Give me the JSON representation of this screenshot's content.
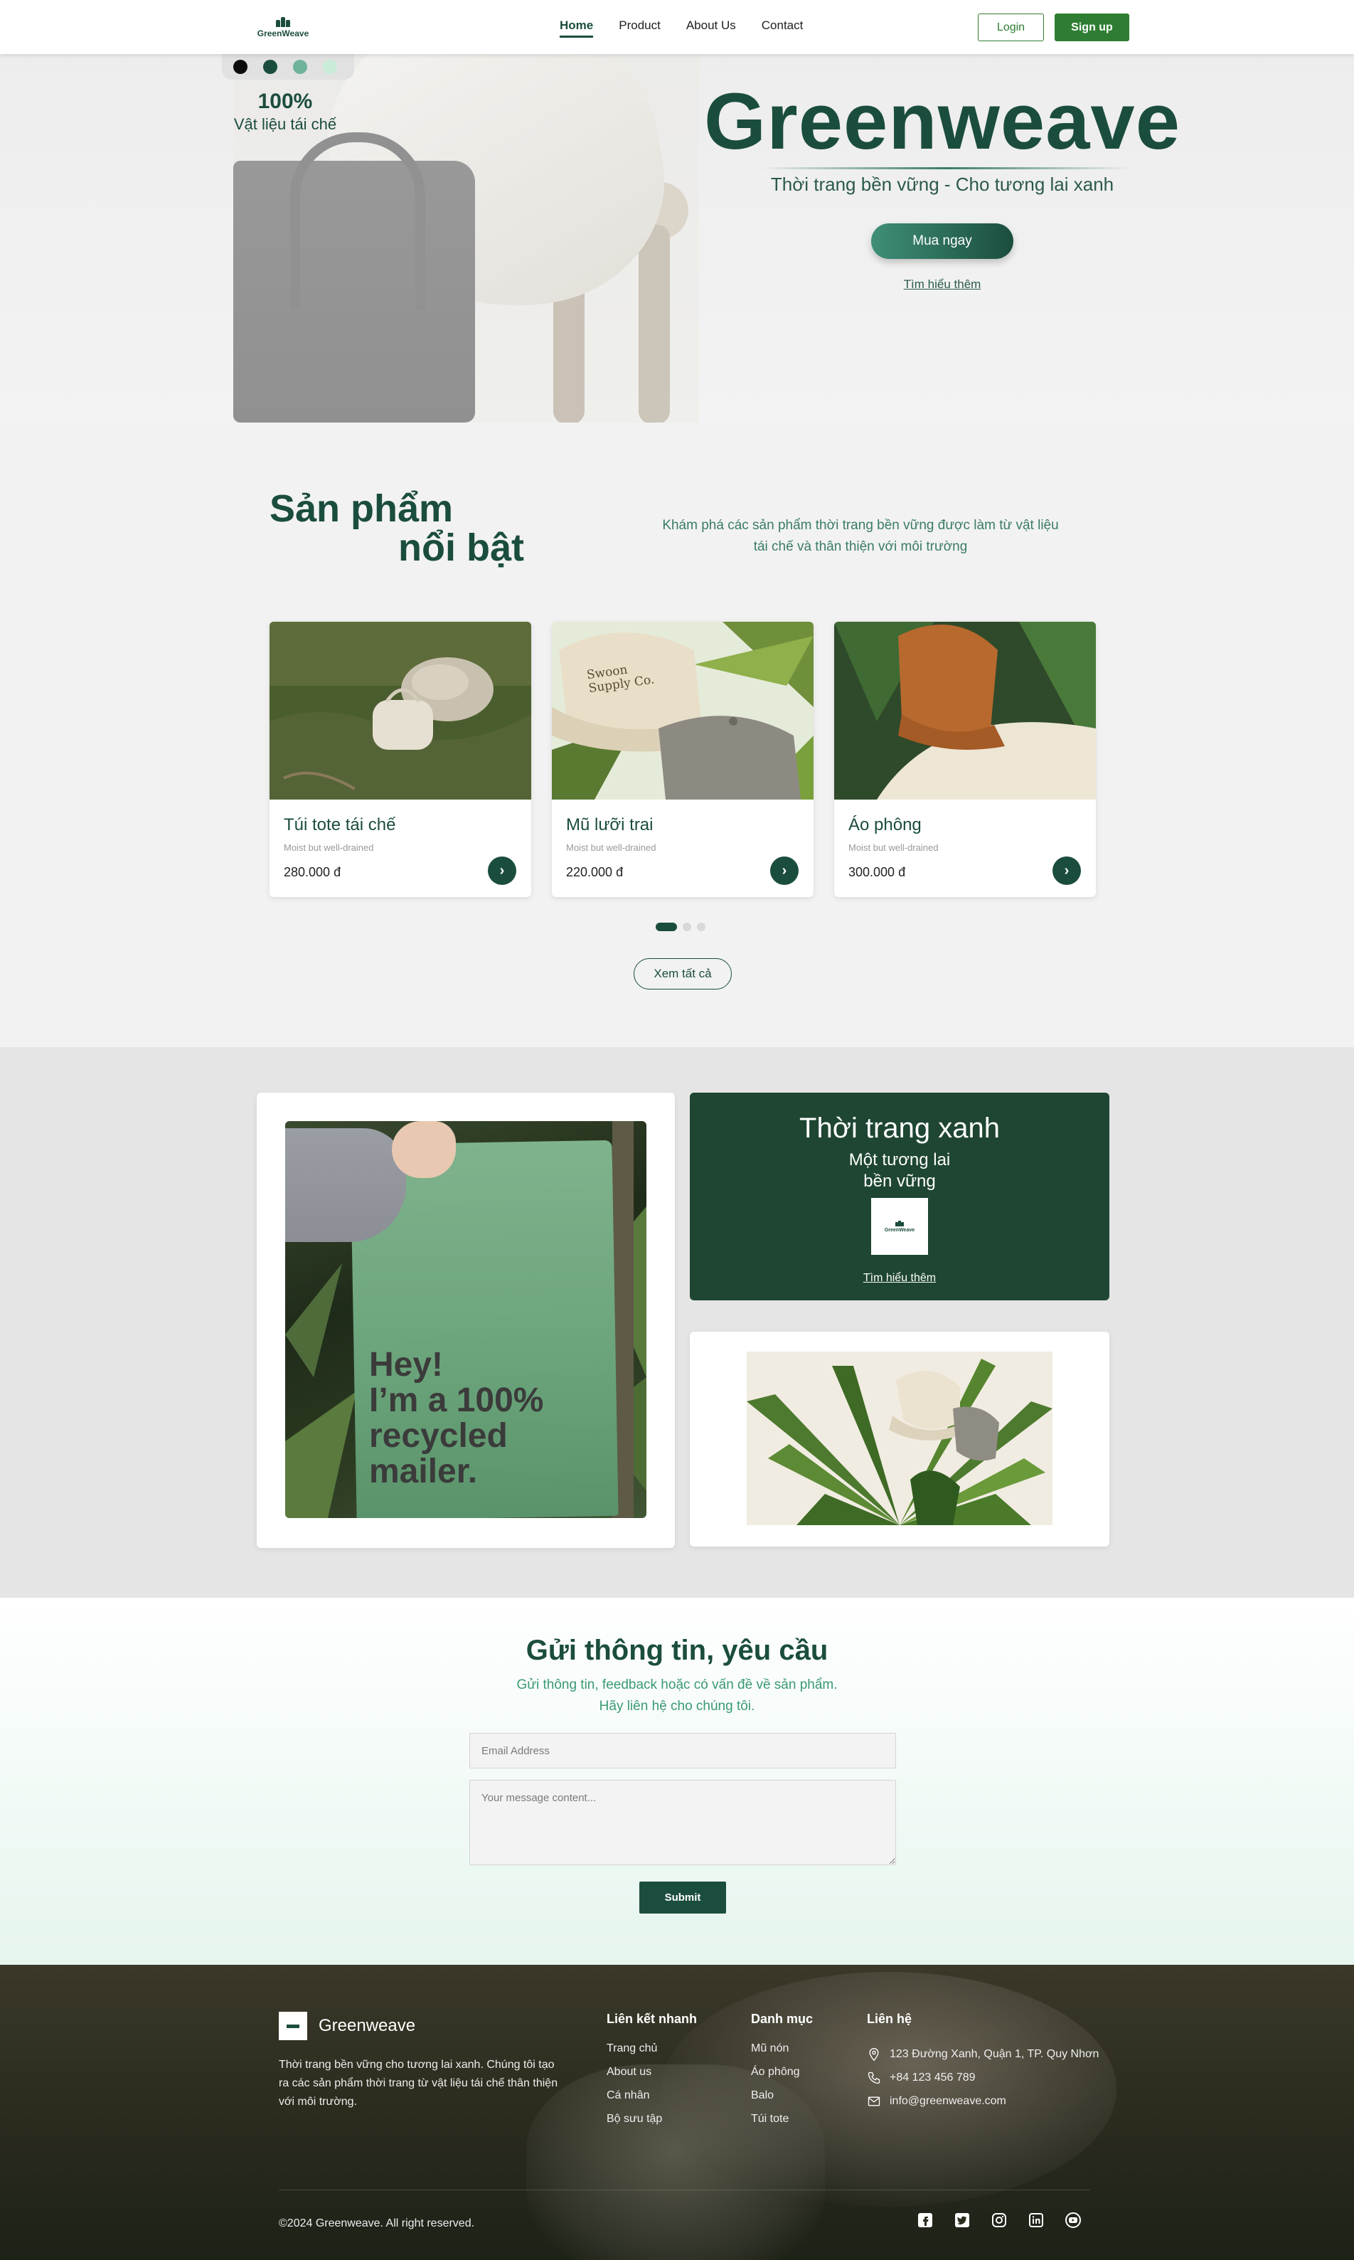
{
  "nav": {
    "logo_text": "GreenWeave",
    "links": [
      "Home",
      "Product",
      "About Us",
      "Contact"
    ],
    "login": "Login",
    "signup": "Sign up"
  },
  "hero": {
    "swatch_colors": [
      "#0d0d0d",
      "#1b4d3e",
      "#6fb49a",
      "#c9ecd9"
    ],
    "stat_value": "100%",
    "stat_label": "Vật liệu tái chế",
    "title": "Greenweave",
    "subtitle": "Thời trang bền vững - Cho tương lai xanh",
    "buy": "Mua ngay",
    "more": "Tìm hiểu thêm"
  },
  "featured": {
    "title_line1": "Sản phẩm",
    "title_line2": "nổi bật",
    "description": "Khám phá các sản phẩm thời trang bền vững được làm từ vật liệu tái chế và thân thiện với môi trường",
    "products": [
      {
        "name": "Túi tote tái chế",
        "sub": "Moist but well-drained",
        "price": "280.000 đ"
      },
      {
        "name": "Mũ lưỡi trai",
        "sub": "Moist but well-drained",
        "price": "220.000 đ"
      },
      {
        "name": "Áo phông",
        "sub": "Moist but well-drained",
        "price": "300.000 đ"
      }
    ],
    "cap_print": "Swoon Supply Co.",
    "view_all": "Xem tất cả"
  },
  "promo": {
    "mailer_text": "Hey!\nI’m a 100%\nrecycled\nmailer.",
    "title": "Thời trang xanh",
    "subtitle_line1": "Một tương lai",
    "subtitle_line2": "bền vững",
    "logo_text": "GreenWeave",
    "more": "Tìm hiểu thêm"
  },
  "contact": {
    "title": "Gửi thông tin, yêu cầu",
    "sub_line1": "Gửi thông tin, feedback hoặc có vấn đề về sản phẩm.",
    "sub_line2": "Hãy liên hệ cho chúng tôi.",
    "email_placeholder": "Email Address",
    "message_placeholder": "Your message content...",
    "submit": "Submit"
  },
  "footer": {
    "brand": "Greenweave",
    "description": "Thời trang bền vững cho tương lai xanh. Chúng tôi tạo ra các sản phẩm thời trang từ vật liệu tái chế thân thiện với môi trường.",
    "quick_links_title": "Liên kết nhanh",
    "quick_links": [
      "Trang chủ",
      "About us",
      "Cá nhân",
      "Bộ sưu tập"
    ],
    "categories_title": "Danh mục",
    "categories": [
      "Mũ nón",
      "Áo phông",
      "Balo",
      "Túi tote"
    ],
    "contact_title": "Liên hệ",
    "address": "123 Đường Xanh, Quận 1, TP. Quy Nhơn",
    "phone": "+84 123 456 789",
    "email": "info@greenweave.com",
    "copyright": "©2024 Greenweave. All right reserved.",
    "socials": [
      "facebook-icon",
      "twitter-icon",
      "instagram-icon",
      "linkedin-icon",
      "youtube-icon"
    ]
  }
}
